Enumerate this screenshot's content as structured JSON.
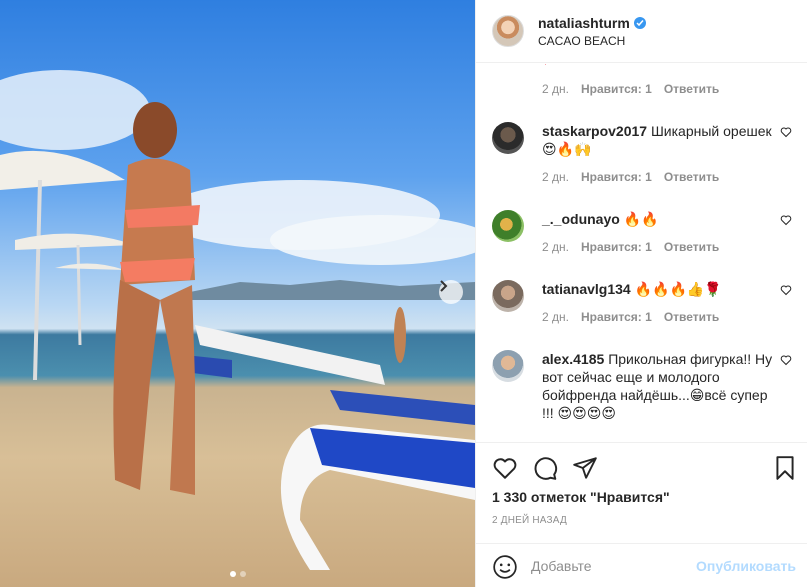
{
  "post": {
    "username": "nataliashturm",
    "location": "CACAO BEACH",
    "likes": "1 330 отметок \"Нравится\"",
    "time_ago": "2 ДНЕЙ НАЗАД"
  },
  "comments": [
    {
      "username": "",
      "text": "",
      "age": "2 дн.",
      "likes": "Нравится: 1",
      "reply": "Ответить",
      "emoji": "♥"
    },
    {
      "username": "staskarpov2017",
      "text": "Шикарный орешек 😍🔥🙌",
      "age": "2 дн.",
      "likes": "Нравится: 1",
      "reply": "Ответить"
    },
    {
      "username": "_._odunayo",
      "text": "🔥🔥",
      "age": "2 дн.",
      "likes": "Нравится: 1",
      "reply": "Ответить"
    },
    {
      "username": "tatianavlg134",
      "text": "🔥🔥🔥👍🌹",
      "age": "2 дн.",
      "likes": "Нравится: 1",
      "reply": "Ответить"
    },
    {
      "username": "alex.4185",
      "text": "Прикольная фигурка!! Ну вот сейчас еще и молодого бойфренда найдёшь...😁всё супер !!! 😍😍😍😍"
    }
  ],
  "comment_box": {
    "placeholder": "Добавьте",
    "post_label": "Опубликовать"
  },
  "colors": {
    "verified": "#3897f0",
    "link_disabled": "#b3dbff",
    "meta_text": "#8e8e8e"
  },
  "carousel": {
    "count": 2,
    "active": 1
  }
}
